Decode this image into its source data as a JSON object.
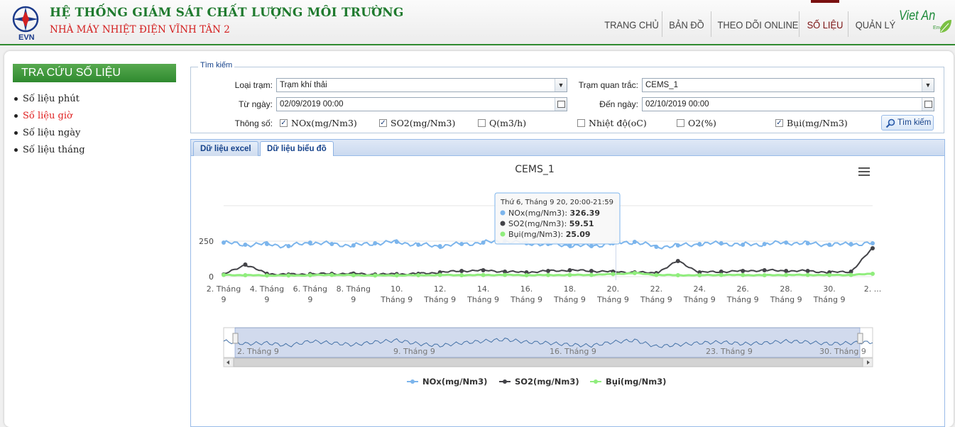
{
  "header": {
    "title": "HỆ THỐNG GIÁM SÁT CHẤT LƯỢNG MÔI TRƯỜNG",
    "subtitle": "NHÀ MÁY NHIỆT ĐIỆN VĨNH TÂN 2",
    "logo_text": "EVN",
    "partner_logo_text": "Viet An",
    "partner_logo_sub": "Enviro",
    "nav": [
      {
        "label": "TRANG CHỦ",
        "active": false
      },
      {
        "label": "BẢN ĐỒ",
        "active": false
      },
      {
        "label": "THEO DÕI ONLINE",
        "active": false
      },
      {
        "label": "SỐ LIỆU",
        "active": true
      },
      {
        "label": "QUẢN LÝ",
        "active": false
      }
    ]
  },
  "sidebar": {
    "title": "TRA CỨU SỐ LIỆU",
    "items": [
      {
        "label": "Số liệu phút",
        "active": false
      },
      {
        "label": "Số liệu giờ",
        "active": true
      },
      {
        "label": "Số liệu ngày",
        "active": false
      },
      {
        "label": "Số liệu tháng",
        "active": false
      }
    ]
  },
  "search": {
    "legend": "Tìm kiếm",
    "station_type_label": "Loại trạm:",
    "station_type_value": "Trạm khí thải",
    "station_label": "Trạm quan trắc:",
    "station_value": "CEMS_1",
    "from_label": "Từ ngày:",
    "from_value": "02/09/2019 00:00",
    "to_label": "Đến ngày:",
    "to_value": "02/10/2019 00:00",
    "params_label": "Thông số:",
    "params": [
      {
        "label": "NOx(mg/Nm3)",
        "checked": true
      },
      {
        "label": "SO2(mg/Nm3)",
        "checked": true
      },
      {
        "label": "Q(m3/h)",
        "checked": false
      },
      {
        "label": "Nhiệt độ(oC)",
        "checked": false
      },
      {
        "label": "O2(%)",
        "checked": false
      },
      {
        "label": "Bụi(mg/Nm3)",
        "checked": true
      }
    ],
    "button_label": "Tìm kiếm"
  },
  "tabs": [
    {
      "label": "Dữ liệu excel",
      "active": false
    },
    {
      "label": "Dữ liệu biểu đồ",
      "active": true
    }
  ],
  "chart_data": {
    "type": "line",
    "title": "CEMS_1",
    "x_tick_labels": [
      "2. Tháng 9",
      "4. Tháng 9",
      "6. Tháng 9",
      "8. Tháng 9",
      "10. Tháng 9",
      "12. Tháng 9",
      "14. Tháng 9",
      "16. Tháng 9",
      "18. Tháng 9",
      "20. Tháng 9",
      "22. Tháng 9",
      "24. Tháng 9",
      "26. Tháng 9",
      "28. Tháng 9",
      "30. Tháng 9",
      "2. ..."
    ],
    "y_ticks": [
      0,
      250
    ],
    "ylim": [
      0,
      500
    ],
    "x": [
      "2019-09-02",
      "2019-09-03",
      "2019-09-04",
      "2019-09-05",
      "2019-09-06",
      "2019-09-07",
      "2019-09-08",
      "2019-09-09",
      "2019-09-10",
      "2019-09-11",
      "2019-09-12",
      "2019-09-13",
      "2019-09-14",
      "2019-09-15",
      "2019-09-16",
      "2019-09-17",
      "2019-09-18",
      "2019-09-19",
      "2019-09-20",
      "2019-09-21",
      "2019-09-22",
      "2019-09-23",
      "2019-09-24",
      "2019-09-25",
      "2019-09-26",
      "2019-09-27",
      "2019-09-28",
      "2019-09-29",
      "2019-09-30",
      "2019-10-01",
      "2019-10-02"
    ],
    "series": [
      {
        "name": "NOx(mg/Nm3)",
        "color": "#7cb5ec",
        "values": [
          240,
          225,
          230,
          215,
          240,
          230,
          220,
          235,
          245,
          225,
          215,
          230,
          240,
          250,
          235,
          230,
          220,
          215,
          235,
          245,
          210,
          220,
          230,
          235,
          225,
          230,
          240,
          235,
          225,
          230,
          235
        ]
      },
      {
        "name": "SO2(mg/Nm3)",
        "color": "#434348",
        "values": [
          15,
          85,
          20,
          15,
          18,
          20,
          22,
          15,
          18,
          20,
          30,
          40,
          45,
          35,
          30,
          40,
          45,
          40,
          35,
          30,
          25,
          110,
          30,
          35,
          40,
          45,
          40,
          40,
          30,
          35,
          200
        ]
      },
      {
        "name": "Bụi(mg/Nm3)",
        "color": "#90ed7d",
        "values": [
          12,
          10,
          8,
          8,
          10,
          12,
          10,
          8,
          9,
          10,
          12,
          10,
          11,
          12,
          10,
          11,
          12,
          12,
          18,
          25,
          12,
          10,
          10,
          12,
          11,
          10,
          12,
          12,
          11,
          12,
          20
        ]
      }
    ],
    "legend_position": "bottom",
    "tooltip": {
      "header": "Thứ 6, Tháng 9 20, 20:00-21:59",
      "rows": [
        {
          "label": "NOx(mg/Nm3):",
          "value": "326.39",
          "color": "#7cb5ec"
        },
        {
          "label": "SO2(mg/Nm3):",
          "value": "59.51",
          "color": "#434348"
        },
        {
          "label": "Bụi(mg/Nm3):",
          "value": "25.09",
          "color": "#90ed7d"
        }
      ]
    },
    "navigator_labels": [
      "2. Tháng 9",
      "9. Tháng 9",
      "16. Tháng 9",
      "23. Tháng 9",
      "30. Tháng 9"
    ]
  }
}
